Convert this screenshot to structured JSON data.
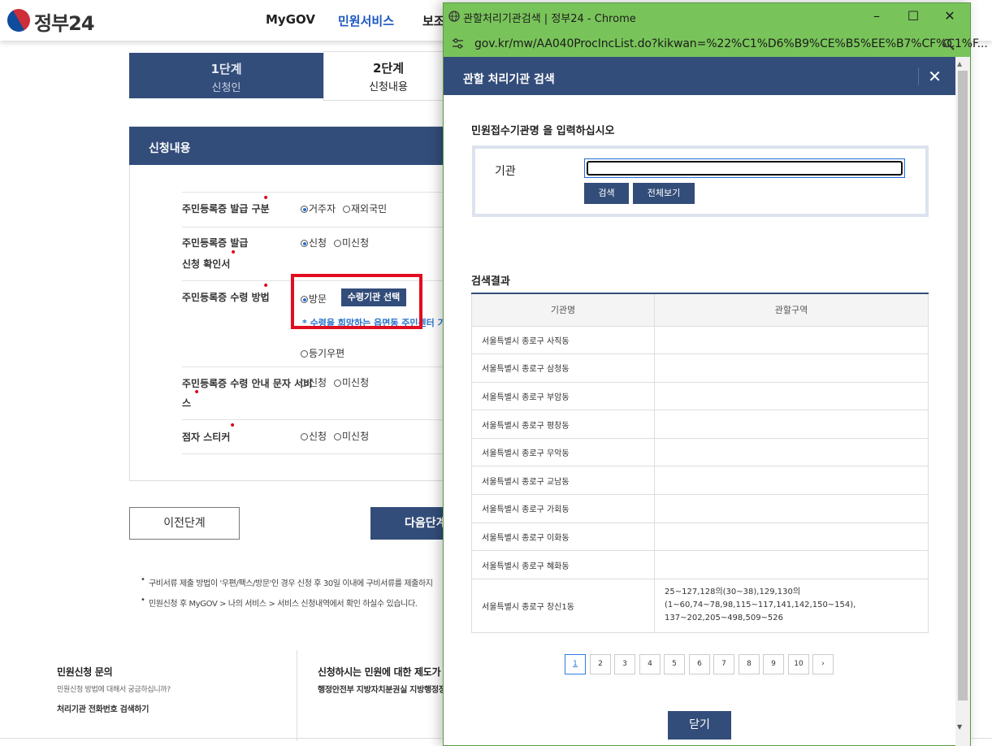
{
  "header": {
    "logo_text": "정부24",
    "nav": [
      "MyGOV",
      "민원서비스",
      "보조"
    ],
    "nav_active": 1
  },
  "steps": [
    {
      "num": "1단계",
      "label": "신청인"
    },
    {
      "num": "2단계",
      "label": "신청내용"
    }
  ],
  "form": {
    "title": "신청내용",
    "rows": [
      {
        "label": "주민등록증 발급 구분",
        "options": [
          "거주자",
          "재외국민"
        ],
        "selected": 0
      },
      {
        "label1": "주민등록증 발급",
        "label2": "신청 확인서",
        "options": [
          "신청",
          "미신청"
        ],
        "selected": 0
      },
      {
        "label": "주민등록증 수령 방법",
        "options": [
          "방문",
          "등기우편"
        ],
        "selected": 0,
        "button": "수령기관 선택",
        "note": "* 수령을 희망하는 읍면동 주민센터 기관"
      },
      {
        "label1": "주민등록증 수령 안내 문자 서비",
        "label2": "스",
        "options": [
          "신청",
          "미신청"
        ],
        "selected": -1
      },
      {
        "label": "점자 스티커",
        "options": [
          "신청",
          "미신청"
        ],
        "selected": -1
      }
    ],
    "required_mark": "•",
    "prev_label": "이전단계",
    "next_label": "다음단계"
  },
  "notes": [
    "구비서류 제출 방법이 '우편/팩스/방문'인 경우 신청 후 30일 이내에 구비서류를 제출하지",
    "민원신청 후 MyGOV > 나의 서비스 > 서비스 신청내역에서 확인 하실수 있습니다."
  ],
  "bullet": "•",
  "footer": {
    "col1_title": "민원신청 문의",
    "col1_sub": "민원신청 방법에 대해서 궁금하십니까?",
    "col1_link": "처리기관 전화번호 검색하기",
    "col2_title": "신청하시는 민원에 대한 제도가 궁",
    "col2_sub": "행정안전부 지방자치분권실 지방행정정"
  },
  "popup": {
    "window_title": "관할처리기관검색 | 정부24 - Chrome",
    "url": "gov.kr/mw/AA040ProcIncList.do?kikwan=%22%C1%D6%B9%CE%B5%EE%B7%CF%C1%F...",
    "dialog_title": "관할 처리기관 검색",
    "prompt": "민원접수기관명 을 입력하십시오",
    "agency_label": "기관",
    "agency_value": "",
    "search_btn": "검색",
    "view_all_btn": "전체보기",
    "results_title": "검색결과",
    "columns": [
      "기관명",
      "관할구역"
    ],
    "rows": [
      {
        "name": "서울특별시 종로구 사직동",
        "area": ""
      },
      {
        "name": "서울특별시 종로구 삼청동",
        "area": ""
      },
      {
        "name": "서울특별시 종로구 부암동",
        "area": ""
      },
      {
        "name": "서울특별시 종로구 평창동",
        "area": ""
      },
      {
        "name": "서울특별시 종로구 무악동",
        "area": ""
      },
      {
        "name": "서울특별시 종로구 교남동",
        "area": ""
      },
      {
        "name": "서울특별시 종로구 가회동",
        "area": ""
      },
      {
        "name": "서울특별시 종로구 이화동",
        "area": ""
      },
      {
        "name": "서울특별시 종로구 혜화동",
        "area": ""
      },
      {
        "name": "서울특별시 종로구 창신1동",
        "area_lines": [
          "25~127,128의(30~38),129,130의 (1~60,74~78,98,115~117,141,142,150~154),",
          "137~202,205~498,509~526"
        ]
      }
    ],
    "pages": [
      "1",
      "2",
      "3",
      "4",
      "5",
      "6",
      "7",
      "8",
      "9",
      "10"
    ],
    "current_page": "1",
    "next_page_icon": "chevron-right-icon",
    "close_btn": "닫기",
    "close_icon": "close-icon"
  },
  "colors": {
    "primary": "#334d7a",
    "chrome_frame": "#79c45a",
    "highlight": "#e10d20",
    "link": "#2872c8"
  }
}
